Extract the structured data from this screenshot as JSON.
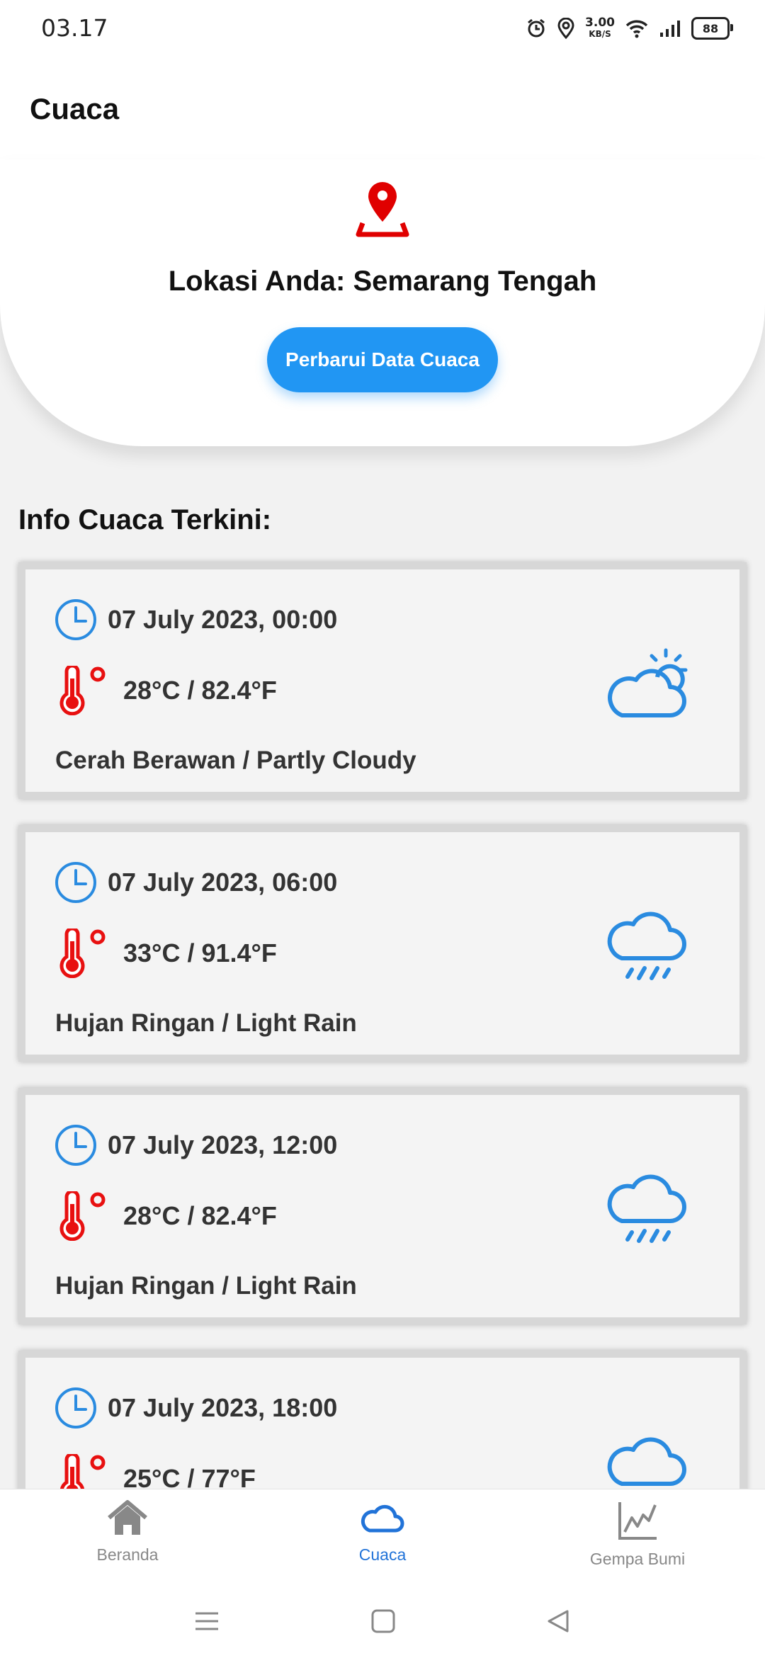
{
  "status_bar": {
    "time": "03.17",
    "net_speed_value": "3.00",
    "net_speed_unit": "KB/S",
    "battery": "88",
    "icons": [
      "alarm-icon",
      "location-icon",
      "wifi-icon",
      "signal-icon",
      "battery-icon"
    ]
  },
  "app_bar": {
    "title": "Cuaca"
  },
  "location": {
    "label": "Lokasi Anda: Semarang Tengah",
    "refresh_button": "Perbarui Data Cuaca",
    "icon": "map-pin-icon"
  },
  "section_title": "Info Cuaca Terkini:",
  "forecasts": [
    {
      "datetime": "07 July 2023, 00:00",
      "temperature": "28°C / 82.4°F",
      "condition": "Cerah Berawan / Partly Cloudy",
      "icon": "partly-cloudy-icon"
    },
    {
      "datetime": "07 July 2023, 06:00",
      "temperature": "33°C / 91.4°F",
      "condition": "Hujan Ringan / Light Rain",
      "icon": "light-rain-icon"
    },
    {
      "datetime": "07 July 2023, 12:00",
      "temperature": "28°C / 82.4°F",
      "condition": "Hujan Ringan / Light Rain",
      "icon": "light-rain-icon"
    },
    {
      "datetime": "07 July 2023, 18:00",
      "temperature": "25°C / 77°F",
      "condition": "",
      "icon": "cloud-icon"
    }
  ],
  "bottom_nav": {
    "items": [
      {
        "label": "Beranda",
        "icon": "home-icon",
        "active": false
      },
      {
        "label": "Cuaca",
        "icon": "cloud-icon",
        "active": true
      },
      {
        "label": "Gempa Bumi",
        "icon": "chart-icon",
        "active": false
      }
    ]
  },
  "colors": {
    "accent": "#2196f3",
    "active_nav": "#2173d8",
    "temperature_icon": "#e81010",
    "pin": "#e00000"
  }
}
